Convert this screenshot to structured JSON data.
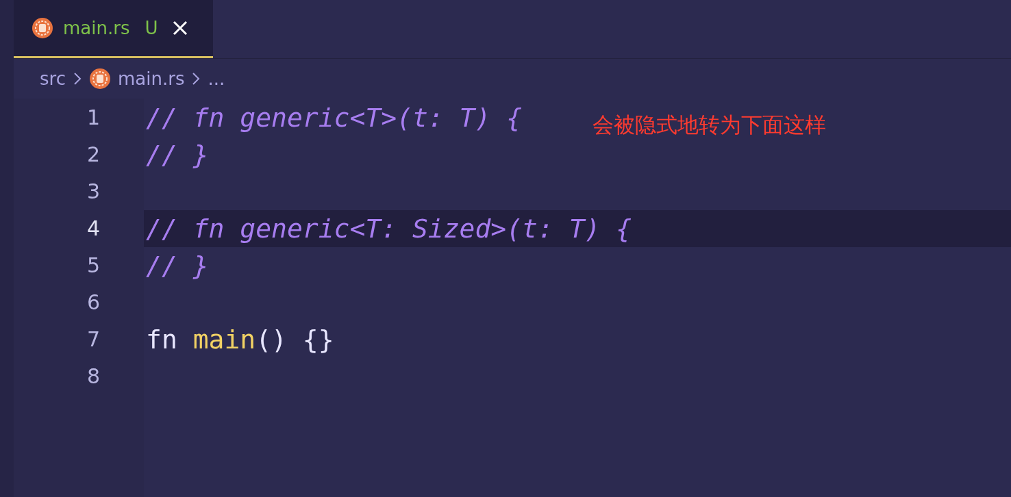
{
  "tabs": [
    {
      "label": "main.rs",
      "status": "U",
      "selected": true
    }
  ],
  "breadcrumb": [
    "src",
    "main.rs",
    "..."
  ],
  "editor": {
    "lines": [
      {
        "number": "1",
        "selected": false,
        "tokens": [
          {
            "kind": "comment",
            "text": "// fn generic<T>(t: T) {"
          }
        ]
      },
      {
        "number": "2",
        "selected": false,
        "tokens": [
          {
            "kind": "comment",
            "text": "// }"
          }
        ]
      },
      {
        "number": "3",
        "selected": false
      },
      {
        "number": "4",
        "selected": true,
        "tokens": [
          {
            "kind": "comment",
            "text": "// fn generic<T: Sized>(t: T) {"
          }
        ]
      },
      {
        "number": "5",
        "selected": false,
        "tokens": [
          {
            "kind": "comment",
            "text": "// }"
          }
        ]
      },
      {
        "number": "6",
        "selected": false
      },
      {
        "number": "7",
        "selected": false,
        "tokens": [
          {
            "kind": "keyword",
            "text": "fn "
          },
          {
            "kind": "function",
            "text": "main"
          },
          {
            "kind": "punctuation",
            "text": "() {}"
          }
        ]
      },
      {
        "number": "8",
        "selected": false
      }
    ],
    "annotation": "会被隐式地转为下面这样"
  }
}
